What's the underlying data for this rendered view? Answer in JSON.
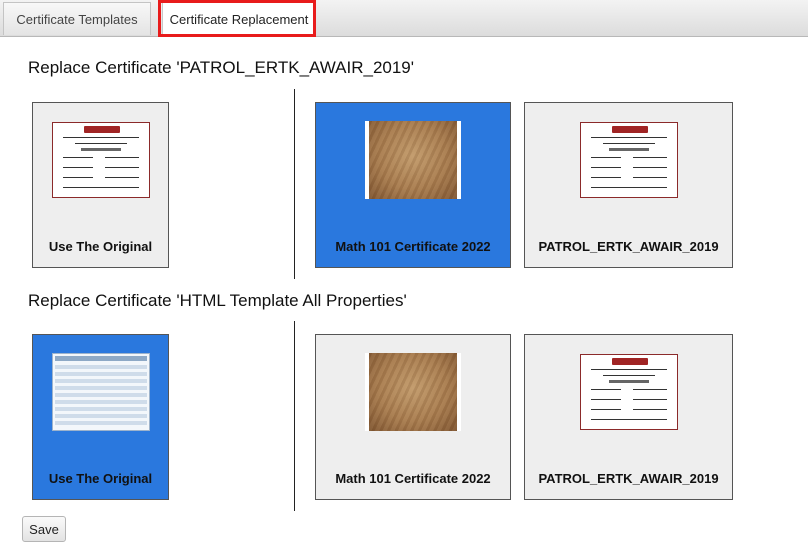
{
  "tabs": [
    {
      "label": "Certificate Templates",
      "active": false
    },
    {
      "label": "Certificate Replacement",
      "active": true
    }
  ],
  "sections": [
    {
      "title": "Replace Certificate 'PATROL_ERTK_AWAIR_2019'",
      "original": {
        "label": "Use The Original",
        "thumbnail": "certificate-icon",
        "selected": false
      },
      "options": [
        {
          "label": "Math 101 Certificate 2022",
          "thumbnail": "parchment-icon",
          "selected": true
        },
        {
          "label": "PATROL_ERTK_AWAIR_2019",
          "thumbnail": "certificate-icon",
          "selected": false
        }
      ]
    },
    {
      "title": "Replace Certificate 'HTML Template All Properties'",
      "original": {
        "label": "Use The Original",
        "thumbnail": "html-table-icon",
        "selected": true
      },
      "options": [
        {
          "label": "Math 101 Certificate 2022",
          "thumbnail": "parchment-icon",
          "selected": false
        },
        {
          "label": "PATROL_ERTK_AWAIR_2019",
          "thumbnail": "certificate-icon",
          "selected": false
        }
      ]
    }
  ],
  "save_label": "Save",
  "colors": {
    "selected": "#2a78de",
    "unselected": "#eeeeee",
    "highlight": "#e81b1b"
  }
}
